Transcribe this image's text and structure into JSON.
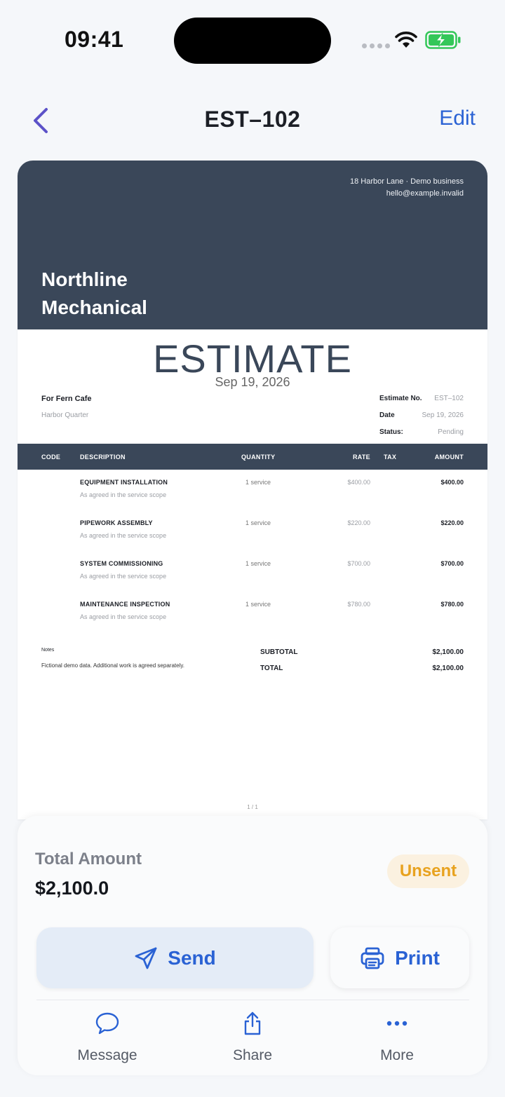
{
  "status_bar": {
    "time": "09:41"
  },
  "nav": {
    "title": "EST–102",
    "edit_label": "Edit"
  },
  "document": {
    "address_line1": "18 Harbor Lane · Demo business",
    "address_line2": "hello@example.invalid",
    "company_line1": "Northline",
    "company_line2": "Mechanical",
    "heading": "ESTIMATE",
    "heading_date": "Sep 19, 2026",
    "bill_to": "For Fern Cafe",
    "bill_to_sub": "Harbor Quarter",
    "meta": [
      {
        "label": "Estimate No.",
        "value": "EST–102"
      },
      {
        "label": "Date",
        "value": "Sep 19, 2026"
      },
      {
        "label": "Status:",
        "value": "Pending"
      }
    ],
    "columns": {
      "code": "CODE",
      "description": "DESCRIPTION",
      "quantity": "QUANTITY",
      "rate": "RATE",
      "tax": "TAX",
      "amount": "AMOUNT"
    },
    "items": [
      {
        "description": "EQUIPMENT INSTALLATION",
        "sub": "As agreed in the service scope",
        "quantity": "1 service",
        "rate": "$400.00",
        "amount": "$400.00"
      },
      {
        "description": "PIPEWORK ASSEMBLY",
        "sub": "As agreed in the service scope",
        "quantity": "1 service",
        "rate": "$220.00",
        "amount": "$220.00"
      },
      {
        "description": "SYSTEM COMMISSIONING",
        "sub": "As agreed in the service scope",
        "quantity": "1 service",
        "rate": "$700.00",
        "amount": "$700.00"
      },
      {
        "description": "MAINTENANCE INSPECTION",
        "sub": "As agreed in the service scope",
        "quantity": "1 service",
        "rate": "$780.00",
        "amount": "$780.00"
      }
    ],
    "notes_label": "Notes",
    "notes_text": "Fictional demo data. Additional work is agreed separately.",
    "subtotal_label": "SUBTOTAL",
    "subtotal_value": "$2,100.00",
    "total_label": "TOTAL",
    "total_value": "$2,100.00",
    "page_num": "1 / 1"
  },
  "sheet": {
    "total_label": "Total Amount",
    "total_value": "$2,100.0",
    "status": "Unsent",
    "send_label": "Send",
    "print_label": "Print",
    "actions": [
      {
        "label": "Message",
        "icon": "message-icon"
      },
      {
        "label": "Share",
        "icon": "share-icon"
      },
      {
        "label": "More",
        "icon": "more-icon"
      }
    ]
  },
  "colors": {
    "accent": "#2a62d4",
    "header": "#3a4759",
    "status_warn": "#e8a21f"
  }
}
